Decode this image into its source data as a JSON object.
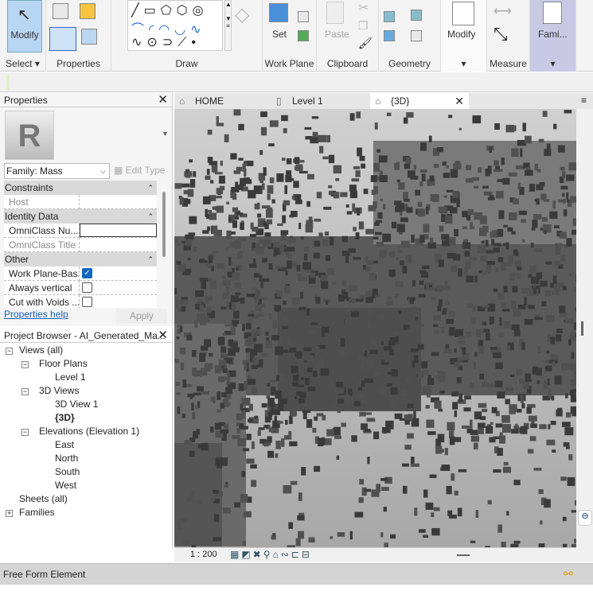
{
  "ribbon": {
    "modify_button": "Modify",
    "panels": {
      "select": "Select ▾",
      "properties": "Properties",
      "draw": "Draw",
      "work_plane": "Work Plane",
      "clipboard": "Clipboard",
      "geometry": "Geometry",
      "modify_dropdown": "▾",
      "measure": "Measure",
      "family_dropdown": "▾"
    },
    "set_button": "Set",
    "paste_button": "Paste",
    "modify2_button": "Modify",
    "family_button": "Fami..."
  },
  "properties": {
    "title": "Properties",
    "type_selector": "Family: Mass",
    "edit_type": "Edit Type",
    "groups": [
      {
        "name": "Constraints",
        "rows": [
          {
            "label": "Host",
            "value": "",
            "type": "text",
            "disabled": true
          }
        ]
      },
      {
        "name": "Identity Data",
        "rows": [
          {
            "label": "OmniClass Nu...",
            "value": "",
            "type": "input"
          },
          {
            "label": "OmniClass Title",
            "value": "",
            "type": "text",
            "disabled": true
          }
        ]
      },
      {
        "name": "Other",
        "rows": [
          {
            "label": "Work Plane-Bas...",
            "checked": true,
            "type": "check"
          },
          {
            "label": "Always vertical",
            "checked": false,
            "type": "check"
          },
          {
            "label": "Cut with Voids ...",
            "checked": false,
            "type": "check"
          }
        ]
      }
    ],
    "help_link": "Properties help",
    "apply_button": "Apply"
  },
  "browser": {
    "title": "Project Browser - AI_Generated_Ma...",
    "nodes": [
      {
        "label": "Views (all)",
        "level": 0,
        "toggle": "-"
      },
      {
        "label": "Floor Plans",
        "level": 1,
        "toggle": "-"
      },
      {
        "label": "Level 1",
        "level": 2
      },
      {
        "label": "3D Views",
        "level": 1,
        "toggle": "-"
      },
      {
        "label": "3D View 1",
        "level": 2
      },
      {
        "label": "{3D}",
        "level": 2,
        "bold": true
      },
      {
        "label": "Elevations (Elevation 1)",
        "level": 1,
        "toggle": "-"
      },
      {
        "label": "East",
        "level": 2
      },
      {
        "label": "North",
        "level": 2
      },
      {
        "label": "South",
        "level": 2
      },
      {
        "label": "West",
        "level": 2
      },
      {
        "label": "Sheets (all)",
        "level": 0
      },
      {
        "label": "Families",
        "level": 0,
        "toggle": "+"
      }
    ]
  },
  "tabs": [
    {
      "label": "HOME",
      "icon": "home-icon"
    },
    {
      "label": "Level 1",
      "icon": "floor-plan-icon"
    },
    {
      "label": "{3D}",
      "icon": "3d-view-icon",
      "active": true
    }
  ],
  "view_control": {
    "scale": "1 : 200"
  },
  "status": {
    "text": "Free Form Element"
  }
}
